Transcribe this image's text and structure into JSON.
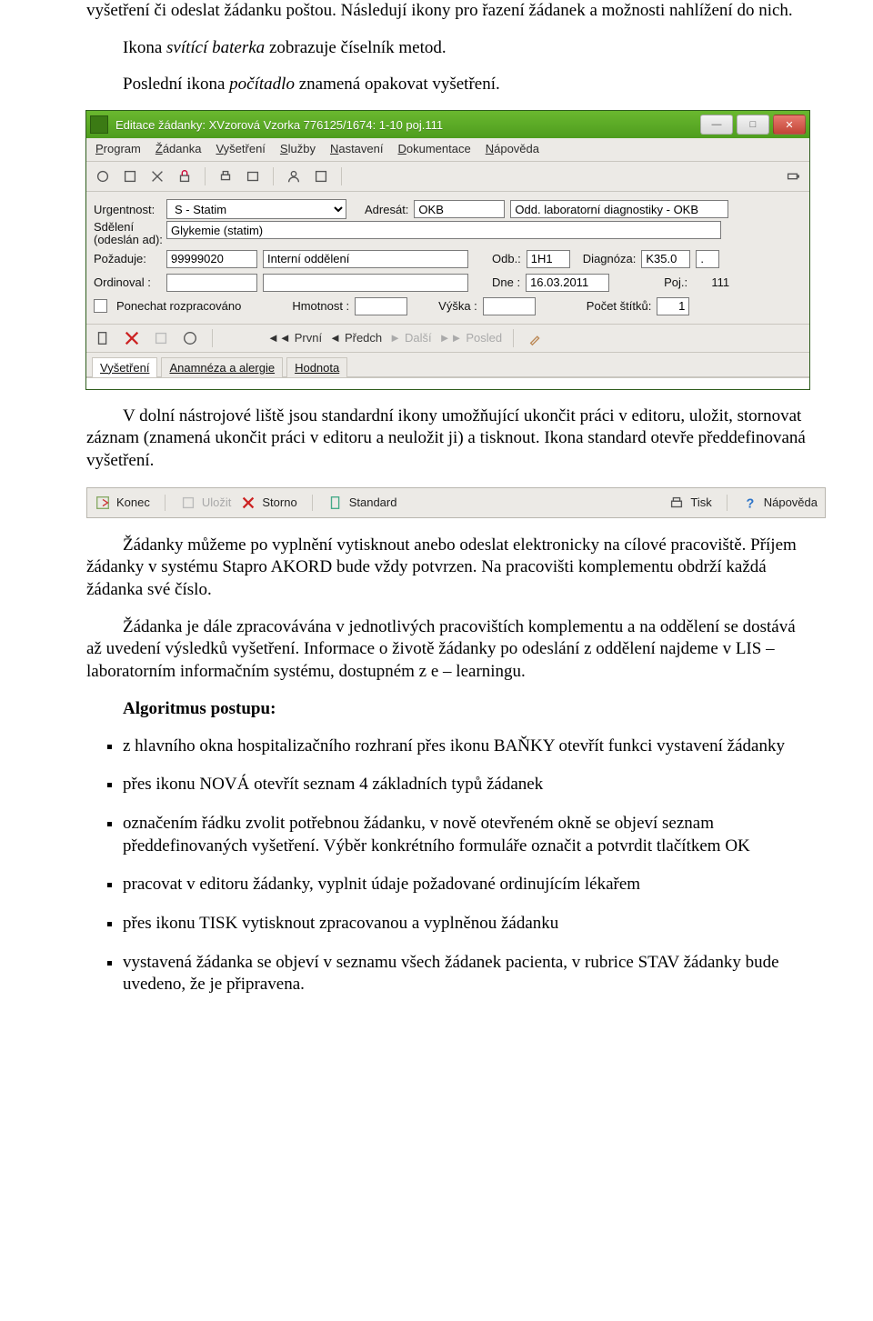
{
  "para1": "vyšetření či odeslat žádanku poštou. Následují ikony pro řazení žádanek a možnosti nahlížení do nich.",
  "para2_pre": "Ikona ",
  "para2_it": "svítící baterka",
  "para2_post": " zobrazuje číselník metod.",
  "para3_pre": "Poslední ikona ",
  "para3_it": "počítadlo",
  "para3_post": " znamená opakovat vyšetření.",
  "window": {
    "title": "Editace žádanky: XVzorová Vzorka 776125/1674: 1-10 poj.111",
    "menu": [
      "Program",
      "Žádanka",
      "Vyšetření",
      "Služby",
      "Nastavení",
      "Dokumentace",
      "Nápověda"
    ],
    "form": {
      "urgentnost_label": "Urgentnost:",
      "urgentnost_value": "S - Statim",
      "adresat_label": "Adresát:",
      "adresat_value": "OKB",
      "adresat_desc": "Odd. laboratorní diagnostiky - OKB",
      "sdeleni_label_line1": "Sdělení",
      "sdeleni_label_line2": "(odeslán ad):",
      "sdeleni_value": "Glykemie (statim)",
      "pozaduje_label": "Požaduje:",
      "pozaduje_val1": "99999020",
      "pozaduje_val2": "Interní oddělení",
      "odb_label": "Odb.:",
      "odb_value": "1H1",
      "diag_label": "Diagnóza:",
      "diag_value": "K35.0",
      "diag_value2": ".",
      "ordinoval_label": "Ordinoval :",
      "dne_label": "Dne :",
      "dne_value": "16.03.2011",
      "poj_label": "Poj.:",
      "poj_value": "111",
      "ponechat_label": "Ponechat rozpracováno",
      "hmotnost_label": "Hmotnost :",
      "vyska_label": "Výška :",
      "pocet_label": "Počet štítků:",
      "pocet_value": "1",
      "nav": {
        "prvni": "První",
        "predch": "Předch",
        "dalsi": "Další",
        "posled": "Posled"
      },
      "tabs": [
        "Vyšetření",
        "Anamnéza a alergie",
        "Hodnota"
      ]
    }
  },
  "para4": "V dolní nástrojové liště jsou standardní ikony umožňující ukončit práci v editoru, uložit, stornovat záznam (znamená ukončit práci v editoru a neuložit ji) a tisknout. Ikona standard otevře předdefinovaná vyšetření.",
  "bar2": {
    "konec": "Konec",
    "ulozit": "Uložit",
    "storno": "Storno",
    "standard": "Standard",
    "tisk": "Tisk",
    "napoveda": "Nápověda"
  },
  "para5": "Žádanky můžeme po vyplnění vytisknout anebo odeslat elektronicky na cílové pracoviště. Příjem žádanky v systému Stapro AKORD bude vždy potvrzen. Na pracovišti komplementu obdrží každá žádanka své číslo.",
  "para6": "Žádanka je dále zpracovávána v jednotlivých pracovištích komplementu a na oddělení se dostává až uvedení výsledků vyšetření. Informace o životě žádanky po odeslání z oddělení najdeme v LIS – laboratorním informačním systému, dostupném z e – learningu.",
  "para7_bold": "Algoritmus postupu:",
  "bullets": [
    "z hlavního okna hospitalizačního rozhraní přes ikonu BAŇKY otevřít funkci vystavení žádanky",
    "přes ikonu NOVÁ otevřít seznam 4 základních typů žádanek",
    "označením řádku zvolit potřebnou žádanku, v nově otevřeném okně se objeví seznam předdefinovaných vyšetření. Výběr konkrétního formuláře označit a potvrdit tlačítkem OK",
    "pracovat v editoru žádanky, vyplnit údaje požadované ordinujícím lékařem",
    "přes ikonu TISK vytisknout zpracovanou a vyplněnou žádanku",
    "vystavená žádanka se objeví v seznamu všech žádanek pacienta, v rubrice STAV žádanky bude uvedeno, že je připravena."
  ]
}
